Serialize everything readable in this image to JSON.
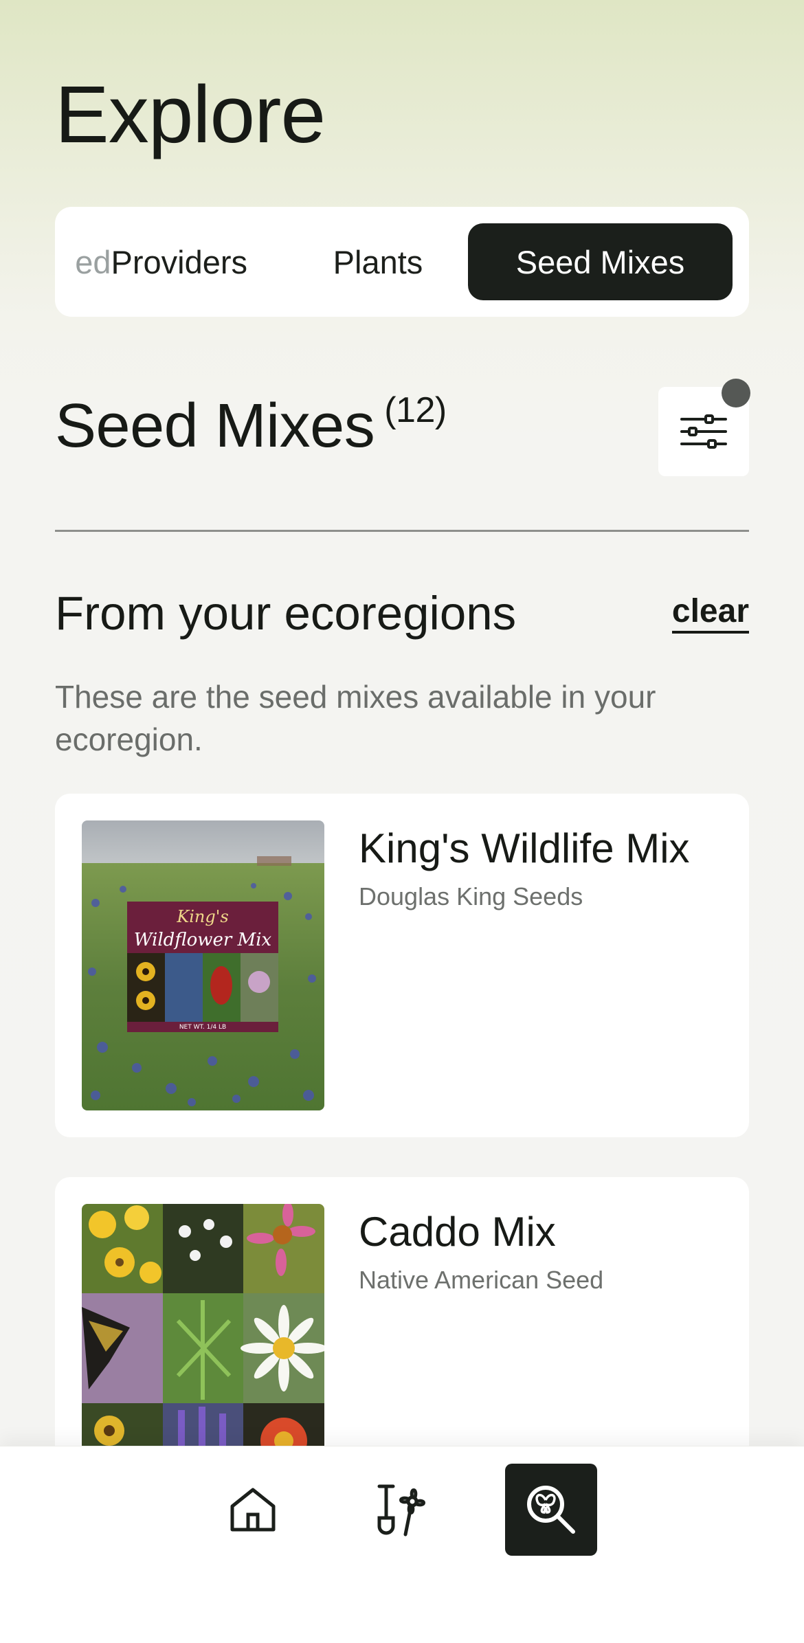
{
  "header": {
    "title": "Explore"
  },
  "tabs": {
    "providers_prefix": "ed ",
    "providers_label": "Providers",
    "plants_label": "Plants",
    "seed_mixes_label": "Seed Mixes"
  },
  "section": {
    "title": "Seed Mixes",
    "count": "(12)"
  },
  "ecoregion": {
    "title": "From your ecoregions",
    "clear_label": "clear",
    "description": "These are the seed mixes available in your ecoregion."
  },
  "cards": [
    {
      "title": "King's Wildlife Mix",
      "provider": "Douglas King Seeds",
      "image_line1": "King's",
      "image_line2": "Wildflower Mix",
      "image_footer": "NET WT. 1/4 LB"
    },
    {
      "title": "Caddo Mix",
      "provider": "Native American Seed"
    }
  ],
  "bottom_nav": {
    "items": [
      "home-icon",
      "garden-tools-icon",
      "explore-search-icon"
    ],
    "active": "explore"
  },
  "colors": {
    "dark": "#1b1f1b",
    "muted_text": "#6a6d6a",
    "card": "#ffffff",
    "gradient_top": "#dfe6c4"
  }
}
